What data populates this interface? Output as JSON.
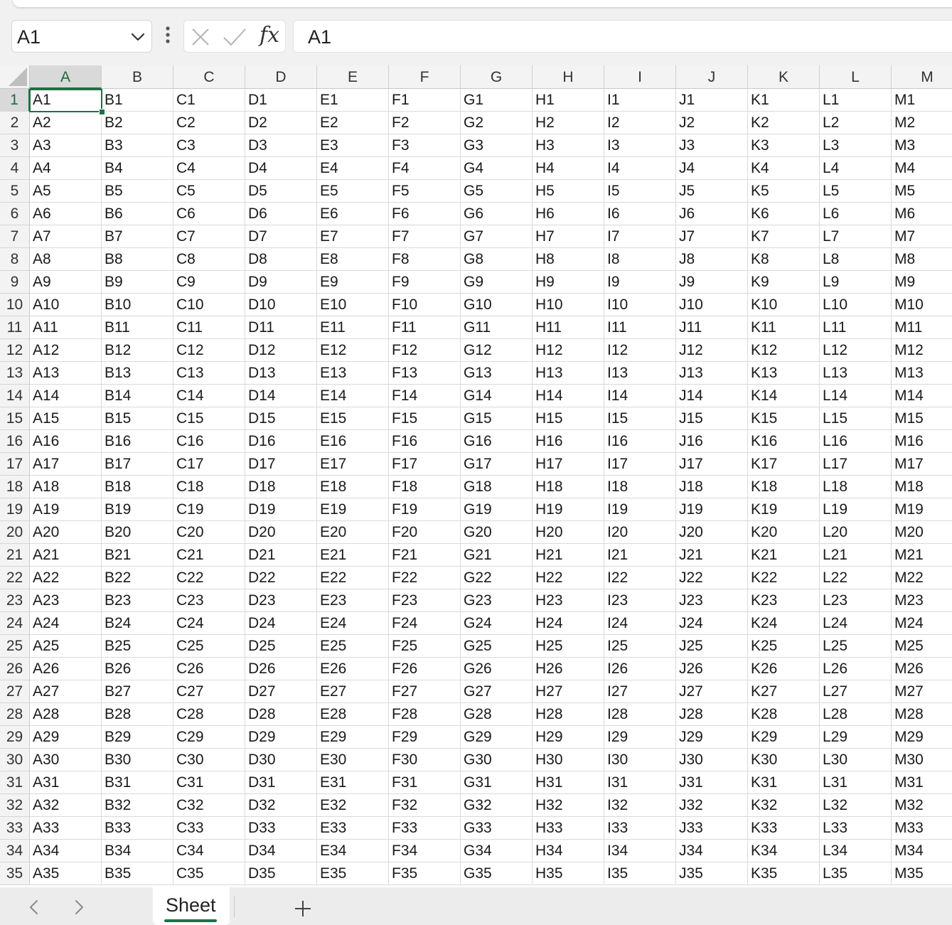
{
  "formula_bar": {
    "namebox_value": "A1",
    "fx_label": "fx",
    "formula_value": "A1"
  },
  "columns": [
    "A",
    "B",
    "C",
    "D",
    "E",
    "F",
    "G",
    "H",
    "I",
    "J",
    "K",
    "L",
    "M"
  ],
  "rows": [
    {
      "num": "1",
      "cells": [
        "A1",
        "B1",
        "C1",
        "D1",
        "E1",
        "F1",
        "G1",
        "H1",
        "I1",
        "J1",
        "K1",
        "L1",
        "M1"
      ]
    },
    {
      "num": "2",
      "cells": [
        "A2",
        "B2",
        "C2",
        "D2",
        "E2",
        "F2",
        "G2",
        "H2",
        "I2",
        "J2",
        "K2",
        "L2",
        "M2"
      ]
    },
    {
      "num": "3",
      "cells": [
        "A3",
        "B3",
        "C3",
        "D3",
        "E3",
        "F3",
        "G3",
        "H3",
        "I3",
        "J3",
        "K3",
        "L3",
        "M3"
      ]
    },
    {
      "num": "4",
      "cells": [
        "A4",
        "B4",
        "C4",
        "D4",
        "E4",
        "F4",
        "G4",
        "H4",
        "I4",
        "J4",
        "K4",
        "L4",
        "M4"
      ]
    },
    {
      "num": "5",
      "cells": [
        "A5",
        "B5",
        "C5",
        "D5",
        "E5",
        "F5",
        "G5",
        "H5",
        "I5",
        "J5",
        "K5",
        "L5",
        "M5"
      ]
    },
    {
      "num": "6",
      "cells": [
        "A6",
        "B6",
        "C6",
        "D6",
        "E6",
        "F6",
        "G6",
        "H6",
        "I6",
        "J6",
        "K6",
        "L6",
        "M6"
      ]
    },
    {
      "num": "7",
      "cells": [
        "A7",
        "B7",
        "C7",
        "D7",
        "E7",
        "F7",
        "G7",
        "H7",
        "I7",
        "J7",
        "K7",
        "L7",
        "M7"
      ]
    },
    {
      "num": "8",
      "cells": [
        "A8",
        "B8",
        "C8",
        "D8",
        "E8",
        "F8",
        "G8",
        "H8",
        "I8",
        "J8",
        "K8",
        "L8",
        "M8"
      ]
    },
    {
      "num": "9",
      "cells": [
        "A9",
        "B9",
        "C9",
        "D9",
        "E9",
        "F9",
        "G9",
        "H9",
        "I9",
        "J9",
        "K9",
        "L9",
        "M9"
      ]
    },
    {
      "num": "10",
      "cells": [
        "A10",
        "B10",
        "C10",
        "D10",
        "E10",
        "F10",
        "G10",
        "H10",
        "I10",
        "J10",
        "K10",
        "L10",
        "M10"
      ]
    },
    {
      "num": "11",
      "cells": [
        "A11",
        "B11",
        "C11",
        "D11",
        "E11",
        "F11",
        "G11",
        "H11",
        "I11",
        "J11",
        "K11",
        "L11",
        "M11"
      ]
    },
    {
      "num": "12",
      "cells": [
        "A12",
        "B12",
        "C12",
        "D12",
        "E12",
        "F12",
        "G12",
        "H12",
        "I12",
        "J12",
        "K12",
        "L12",
        "M12"
      ]
    },
    {
      "num": "13",
      "cells": [
        "A13",
        "B13",
        "C13",
        "D13",
        "E13",
        "F13",
        "G13",
        "H13",
        "I13",
        "J13",
        "K13",
        "L13",
        "M13"
      ]
    },
    {
      "num": "14",
      "cells": [
        "A14",
        "B14",
        "C14",
        "D14",
        "E14",
        "F14",
        "G14",
        "H14",
        "I14",
        "J14",
        "K14",
        "L14",
        "M14"
      ]
    },
    {
      "num": "15",
      "cells": [
        "A15",
        "B15",
        "C15",
        "D15",
        "E15",
        "F15",
        "G15",
        "H15",
        "I15",
        "J15",
        "K15",
        "L15",
        "M15"
      ]
    },
    {
      "num": "16",
      "cells": [
        "A16",
        "B16",
        "C16",
        "D16",
        "E16",
        "F16",
        "G16",
        "H16",
        "I16",
        "J16",
        "K16",
        "L16",
        "M16"
      ]
    },
    {
      "num": "17",
      "cells": [
        "A17",
        "B17",
        "C17",
        "D17",
        "E17",
        "F17",
        "G17",
        "H17",
        "I17",
        "J17",
        "K17",
        "L17",
        "M17"
      ]
    },
    {
      "num": "18",
      "cells": [
        "A18",
        "B18",
        "C18",
        "D18",
        "E18",
        "F18",
        "G18",
        "H18",
        "I18",
        "J18",
        "K18",
        "L18",
        "M18"
      ]
    },
    {
      "num": "19",
      "cells": [
        "A19",
        "B19",
        "C19",
        "D19",
        "E19",
        "F19",
        "G19",
        "H19",
        "I19",
        "J19",
        "K19",
        "L19",
        "M19"
      ]
    },
    {
      "num": "20",
      "cells": [
        "A20",
        "B20",
        "C20",
        "D20",
        "E20",
        "F20",
        "G20",
        "H20",
        "I20",
        "J20",
        "K20",
        "L20",
        "M20"
      ]
    },
    {
      "num": "21",
      "cells": [
        "A21",
        "B21",
        "C21",
        "D21",
        "E21",
        "F21",
        "G21",
        "H21",
        "I21",
        "J21",
        "K21",
        "L21",
        "M21"
      ]
    },
    {
      "num": "22",
      "cells": [
        "A22",
        "B22",
        "C22",
        "D22",
        "E22",
        "F22",
        "G22",
        "H22",
        "I22",
        "J22",
        "K22",
        "L22",
        "M22"
      ]
    },
    {
      "num": "23",
      "cells": [
        "A23",
        "B23",
        "C23",
        "D23",
        "E23",
        "F23",
        "G23",
        "H23",
        "I23",
        "J23",
        "K23",
        "L23",
        "M23"
      ]
    },
    {
      "num": "24",
      "cells": [
        "A24",
        "B24",
        "C24",
        "D24",
        "E24",
        "F24",
        "G24",
        "H24",
        "I24",
        "J24",
        "K24",
        "L24",
        "M24"
      ]
    },
    {
      "num": "25",
      "cells": [
        "A25",
        "B25",
        "C25",
        "D25",
        "E25",
        "F25",
        "G25",
        "H25",
        "I25",
        "J25",
        "K25",
        "L25",
        "M25"
      ]
    },
    {
      "num": "26",
      "cells": [
        "A26",
        "B26",
        "C26",
        "D26",
        "E26",
        "F26",
        "G26",
        "H26",
        "I26",
        "J26",
        "K26",
        "L26",
        "M26"
      ]
    },
    {
      "num": "27",
      "cells": [
        "A27",
        "B27",
        "C27",
        "D27",
        "E27",
        "F27",
        "G27",
        "H27",
        "I27",
        "J27",
        "K27",
        "L27",
        "M27"
      ]
    },
    {
      "num": "28",
      "cells": [
        "A28",
        "B28",
        "C28",
        "D28",
        "E28",
        "F28",
        "G28",
        "H28",
        "I28",
        "J28",
        "K28",
        "L28",
        "M28"
      ]
    },
    {
      "num": "29",
      "cells": [
        "A29",
        "B29",
        "C29",
        "D29",
        "E29",
        "F29",
        "G29",
        "H29",
        "I29",
        "J29",
        "K29",
        "L29",
        "M29"
      ]
    },
    {
      "num": "30",
      "cells": [
        "A30",
        "B30",
        "C30",
        "D30",
        "E30",
        "F30",
        "G30",
        "H30",
        "I30",
        "J30",
        "K30",
        "L30",
        "M30"
      ]
    },
    {
      "num": "31",
      "cells": [
        "A31",
        "B31",
        "C31",
        "D31",
        "E31",
        "F31",
        "G31",
        "H31",
        "I31",
        "J31",
        "K31",
        "L31",
        "M31"
      ]
    },
    {
      "num": "32",
      "cells": [
        "A32",
        "B32",
        "C32",
        "D32",
        "E32",
        "F32",
        "G32",
        "H32",
        "I32",
        "J32",
        "K32",
        "L32",
        "M32"
      ]
    },
    {
      "num": "33",
      "cells": [
        "A33",
        "B33",
        "C33",
        "D33",
        "E33",
        "F33",
        "G33",
        "H33",
        "I33",
        "J33",
        "K33",
        "L33",
        "M33"
      ]
    },
    {
      "num": "34",
      "cells": [
        "A34",
        "B34",
        "C34",
        "D34",
        "E34",
        "F34",
        "G34",
        "H34",
        "I34",
        "J34",
        "K34",
        "L34",
        "M34"
      ]
    },
    {
      "num": "35",
      "cells": [
        "A35",
        "B35",
        "C35",
        "D35",
        "E35",
        "F35",
        "G35",
        "H35",
        "I35",
        "J35",
        "K35",
        "L35",
        "M35"
      ]
    }
  ],
  "selection": {
    "column": "A",
    "row": "1"
  },
  "sheet_tabs": {
    "active_label": "Sheet",
    "prev_icon": "chevron-left-icon",
    "next_icon": "chevron-right-icon",
    "add_icon": "plus-icon"
  },
  "colors": {
    "accent": "#1e7145",
    "header_bg": "#f3f3f3",
    "gridline": "#dadada"
  }
}
